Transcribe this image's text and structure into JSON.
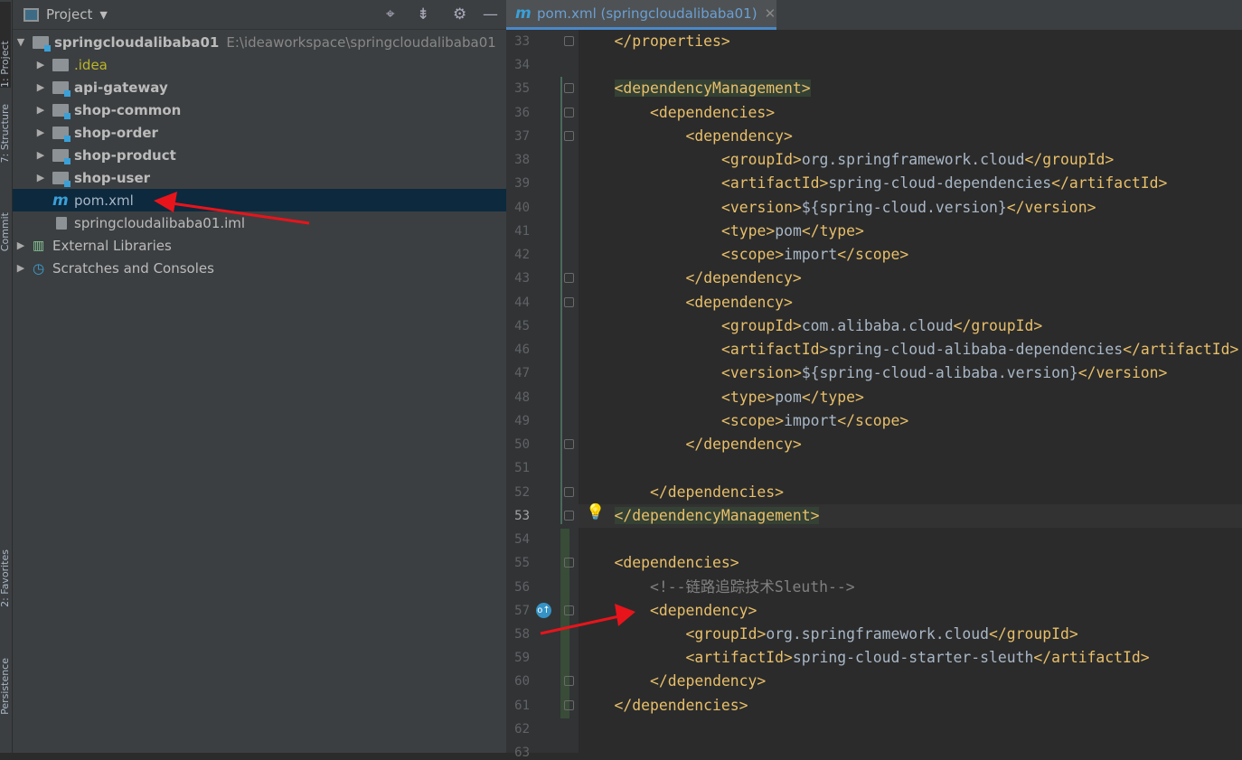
{
  "left_strip": {
    "tabs": [
      "1: Project",
      "7: Structure",
      "Commit",
      "2: Favorites",
      "Persistence"
    ]
  },
  "project_panel": {
    "title": "Project",
    "toolbar_icons": [
      "locate-icon",
      "collapse-all-icon",
      "gear-icon",
      "minimize-icon"
    ],
    "root": {
      "name": "springcloudalibaba01",
      "path": "E:\\ideaworkspace\\springcloudalibaba01"
    },
    "items": [
      {
        "label": ".idea",
        "type": "folder",
        "color": "#bbb529"
      },
      {
        "label": "api-gateway",
        "type": "module"
      },
      {
        "label": "shop-common",
        "type": "module"
      },
      {
        "label": "shop-order",
        "type": "module"
      },
      {
        "label": "shop-product",
        "type": "module"
      },
      {
        "label": "shop-user",
        "type": "module"
      },
      {
        "label": "pom.xml",
        "type": "maven",
        "selected": true
      },
      {
        "label": "springcloudalibaba01.iml",
        "type": "iml"
      }
    ],
    "external_libraries": "External Libraries",
    "scratches": "Scratches and Consoles"
  },
  "editor": {
    "tab": {
      "icon": "m",
      "label": "pom.xml (springcloudalibaba01)"
    },
    "current_line": 53,
    "lines": [
      {
        "n": 33,
        "i": 1,
        "p": [
          [
            "tag",
            "</properties>"
          ]
        ]
      },
      {
        "n": 34,
        "i": 0,
        "p": []
      },
      {
        "n": 35,
        "i": 1,
        "p": [
          [
            "tag",
            "<dependencyManagement>"
          ]
        ],
        "hl": true
      },
      {
        "n": 36,
        "i": 2,
        "p": [
          [
            "tag",
            "<dependencies>"
          ]
        ]
      },
      {
        "n": 37,
        "i": 3,
        "p": [
          [
            "tag",
            "<dependency>"
          ]
        ]
      },
      {
        "n": 38,
        "i": 4,
        "p": [
          [
            "tag",
            "<groupId>"
          ],
          [
            "txt",
            "org.springframework.cloud"
          ],
          [
            "tag",
            "</groupId>"
          ]
        ]
      },
      {
        "n": 39,
        "i": 4,
        "p": [
          [
            "tag",
            "<artifactId>"
          ],
          [
            "txt",
            "spring-cloud-dependencies"
          ],
          [
            "tag",
            "</artifactId>"
          ]
        ]
      },
      {
        "n": 40,
        "i": 4,
        "p": [
          [
            "tag",
            "<version>"
          ],
          [
            "txt",
            "${spring-cloud.version}"
          ],
          [
            "tag",
            "</version>"
          ]
        ]
      },
      {
        "n": 41,
        "i": 4,
        "p": [
          [
            "tag",
            "<type>"
          ],
          [
            "txt",
            "pom"
          ],
          [
            "tag",
            "</type>"
          ]
        ]
      },
      {
        "n": 42,
        "i": 4,
        "p": [
          [
            "tag",
            "<scope>"
          ],
          [
            "txt",
            "import"
          ],
          [
            "tag",
            "</scope>"
          ]
        ]
      },
      {
        "n": 43,
        "i": 3,
        "p": [
          [
            "tag",
            "</dependency>"
          ]
        ]
      },
      {
        "n": 44,
        "i": 3,
        "p": [
          [
            "tag",
            "<dependency>"
          ]
        ]
      },
      {
        "n": 45,
        "i": 4,
        "p": [
          [
            "tag",
            "<groupId>"
          ],
          [
            "txt",
            "com.alibaba.cloud"
          ],
          [
            "tag",
            "</groupId>"
          ]
        ]
      },
      {
        "n": 46,
        "i": 4,
        "p": [
          [
            "tag",
            "<artifactId>"
          ],
          [
            "txt",
            "spring-cloud-alibaba-dependencies"
          ],
          [
            "tag",
            "</artifactId>"
          ]
        ]
      },
      {
        "n": 47,
        "i": 4,
        "p": [
          [
            "tag",
            "<version>"
          ],
          [
            "txt",
            "${spring-cloud-alibaba.version}"
          ],
          [
            "tag",
            "</version>"
          ]
        ]
      },
      {
        "n": 48,
        "i": 4,
        "p": [
          [
            "tag",
            "<type>"
          ],
          [
            "txt",
            "pom"
          ],
          [
            "tag",
            "</type>"
          ]
        ]
      },
      {
        "n": 49,
        "i": 4,
        "p": [
          [
            "tag",
            "<scope>"
          ],
          [
            "txt",
            "import"
          ],
          [
            "tag",
            "</scope>"
          ]
        ]
      },
      {
        "n": 50,
        "i": 3,
        "p": [
          [
            "tag",
            "</dependency>"
          ]
        ]
      },
      {
        "n": 51,
        "i": 0,
        "p": []
      },
      {
        "n": 52,
        "i": 2,
        "p": [
          [
            "tag",
            "</dependencies>"
          ]
        ]
      },
      {
        "n": 53,
        "i": 1,
        "p": [
          [
            "tag",
            "</dependencyManagement>"
          ]
        ],
        "hl": true
      },
      {
        "n": 54,
        "i": 0,
        "p": []
      },
      {
        "n": 55,
        "i": 1,
        "p": [
          [
            "tag",
            "<dependencies>"
          ]
        ]
      },
      {
        "n": 56,
        "i": 2,
        "p": [
          [
            "cmt",
            "<!--链路追踪技术Sleuth-->"
          ]
        ]
      },
      {
        "n": 57,
        "i": 2,
        "p": [
          [
            "tag",
            "<dependency>"
          ]
        ]
      },
      {
        "n": 58,
        "i": 3,
        "p": [
          [
            "tag",
            "<groupId>"
          ],
          [
            "txt",
            "org.springframework.cloud"
          ],
          [
            "tag",
            "</groupId>"
          ]
        ]
      },
      {
        "n": 59,
        "i": 3,
        "p": [
          [
            "tag",
            "<artifactId>"
          ],
          [
            "txt",
            "spring-cloud-starter-sleuth"
          ],
          [
            "tag",
            "</artifactId>"
          ]
        ]
      },
      {
        "n": 60,
        "i": 2,
        "p": [
          [
            "tag",
            "</dependency>"
          ]
        ]
      },
      {
        "n": 61,
        "i": 1,
        "p": [
          [
            "tag",
            "</dependencies>"
          ]
        ]
      },
      {
        "n": 62,
        "i": 0,
        "p": []
      },
      {
        "n": 63,
        "i": 0,
        "p": []
      }
    ],
    "fold_lines": [
      33,
      35,
      36,
      37,
      43,
      44,
      50,
      52,
      53,
      55,
      57,
      60,
      61
    ],
    "annotation_colors": {
      "arrow": "#e8141b",
      "tag": "#e8bf6a",
      "text": "#a9b7c6",
      "comment": "#808080"
    }
  }
}
